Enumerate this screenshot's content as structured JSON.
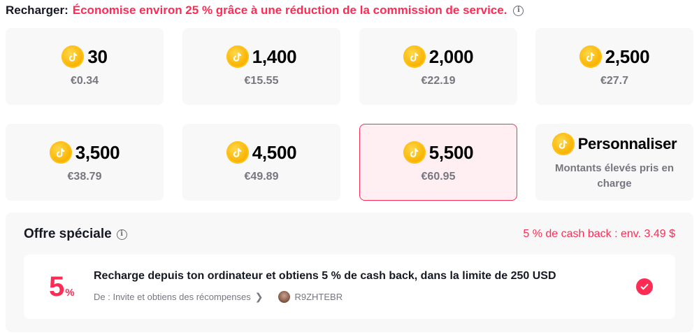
{
  "header": {
    "label": "Recharger:",
    "promo": "Économise environ 25 % grâce à une réduction de la commission de service.",
    "info_icon": "info-icon"
  },
  "packages": [
    {
      "amount": "30",
      "price": "€0.34",
      "selected": false
    },
    {
      "amount": "1,400",
      "price": "€15.55",
      "selected": false
    },
    {
      "amount": "2,000",
      "price": "€22.19",
      "selected": false
    },
    {
      "amount": "2,500",
      "price": "€27.7",
      "selected": false
    },
    {
      "amount": "3,500",
      "price": "€38.79",
      "selected": false
    },
    {
      "amount": "4,500",
      "price": "€49.89",
      "selected": false
    },
    {
      "amount": "5,500",
      "price": "€60.95",
      "selected": true
    }
  ],
  "custom": {
    "label": "Personnaliser",
    "subtitle": "Montants élevés pris en charge"
  },
  "special_offer": {
    "title": "Offre spéciale",
    "cashback": "5 % de cash back : env. 3.49 $",
    "percent": "5",
    "percent_sign": "%",
    "description": "Recharge depuis ton ordinateur et obtiens 5 % de cash back, dans la limite de 250 USD",
    "from": "De : Invite et obtiens des récompenses",
    "code": "R9ZHTEBR",
    "checked": true
  },
  "colors": {
    "accent": "#fe2c55",
    "card_bg": "#f8f8f8",
    "coin": "#f9b300"
  }
}
